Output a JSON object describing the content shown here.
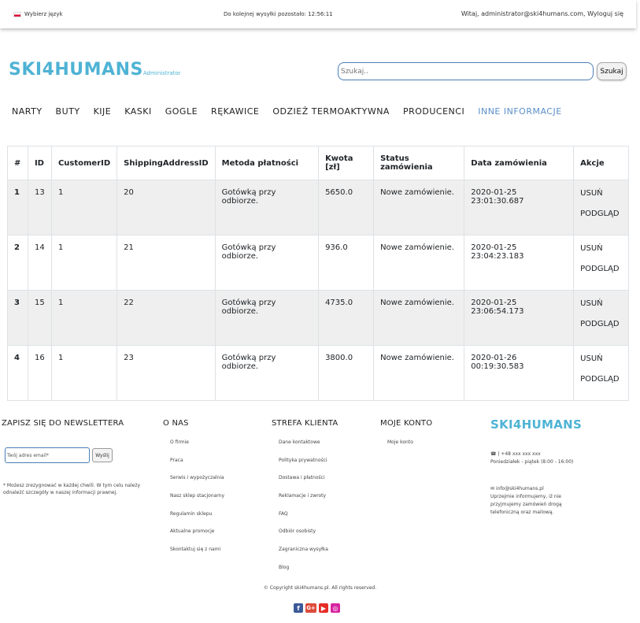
{
  "topbar": {
    "language_label": "Wybierz język",
    "timer_text": "Do kolejnej wysyłki pozostało: 12:56:11",
    "user_text": "Witaj, administrator@ski4humans.com, Wyloguj się"
  },
  "header": {
    "logo_text": "SKI4HUMANS",
    "logo_sub": "Administrator",
    "search_placeholder": "Szukaj..",
    "search_button": "Szukaj"
  },
  "nav": [
    "NARTY",
    "BUTY",
    "KIJE",
    "KASKI",
    "GOGLE",
    "RĘKAWICE",
    "ODZIEŻ TERMOAKTYWNA",
    "PRODUCENCI",
    "INNE INFORMACJE"
  ],
  "table": {
    "headers": [
      "#",
      "ID",
      "CustomerID",
      "ShippingAddressID",
      "Metoda płatności",
      "Kwota [zł]",
      "Status zamówienia",
      "Data zamówienia",
      "Akcje"
    ],
    "rows": [
      [
        "1",
        "13",
        "1",
        "20",
        "Gotówką przy odbiorze.",
        "5650.0",
        "Nowe zamówienie.",
        "2020-01-25 23:01:30.687"
      ],
      [
        "2",
        "14",
        "1",
        "21",
        "Gotówką przy odbiorze.",
        "936.0",
        "Nowe zamówienie.",
        "2020-01-25 23:04:23.183"
      ],
      [
        "3",
        "15",
        "1",
        "22",
        "Gotówką przy odbiorze.",
        "4735.0",
        "Nowe zamówienie.",
        "2020-01-25 23:06:54.173"
      ],
      [
        "4",
        "16",
        "1",
        "23",
        "Gotówką przy odbiorze.",
        "3800.0",
        "Nowe zamówienie.",
        "2020-01-26 00:19:30.583"
      ]
    ],
    "action_delete": "USUŃ",
    "action_view": "PODGLĄD"
  },
  "footer": {
    "newsletter_title": "ZAPISZ SIĘ DO NEWSLETTERA",
    "newsletter_placeholder": "Twój adres email*",
    "newsletter_button": "Wyślij",
    "newsletter_note": "* Możesz zrezygnować w każdej chwili. W tym celu należy odnaleźć szczegóły w naszej informacji prawnej.",
    "about_title": "O NAS",
    "about_links": [
      "O firmie",
      "Praca",
      "Serwis i wypożyczalnia",
      "Nasz sklep stacjonarny",
      "Regulamin sklepu",
      "Aktualne promocje",
      "Skontaktuj się z nami"
    ],
    "client_title": "STREFA KLIENTA",
    "client_links": [
      "Dane kontaktowe",
      "Polityka prywatności",
      "Dostawa i płatności",
      "Reklamacje i zwroty",
      "FAQ",
      "Odbiór osobisty",
      "Zagraniczna wysyłka",
      "Blog"
    ],
    "account_title": "MOJE KONTO",
    "account_links": [
      "Moje konto"
    ],
    "logo_text": "SKI4HUMANS",
    "phone": "| +48 xxx xxx xxx",
    "hours": "Poniedziałek - piątek (8:00 - 16:00)",
    "email": "info@ski4humans.pl",
    "email_note": "Uprzejmie informujemy, iż nie przyjmujemy zamówień drogą telefoniczną oraz mailową.",
    "copyright": "© Copyright ski4humans.pl. All rights reserved."
  },
  "colors": {
    "brand": "#4fb3d4",
    "active_nav": "#5b8fc9",
    "facebook": "#3b5998",
    "google": "#dd4b39",
    "youtube": "#e52d27",
    "instagram": "#d6249f"
  }
}
